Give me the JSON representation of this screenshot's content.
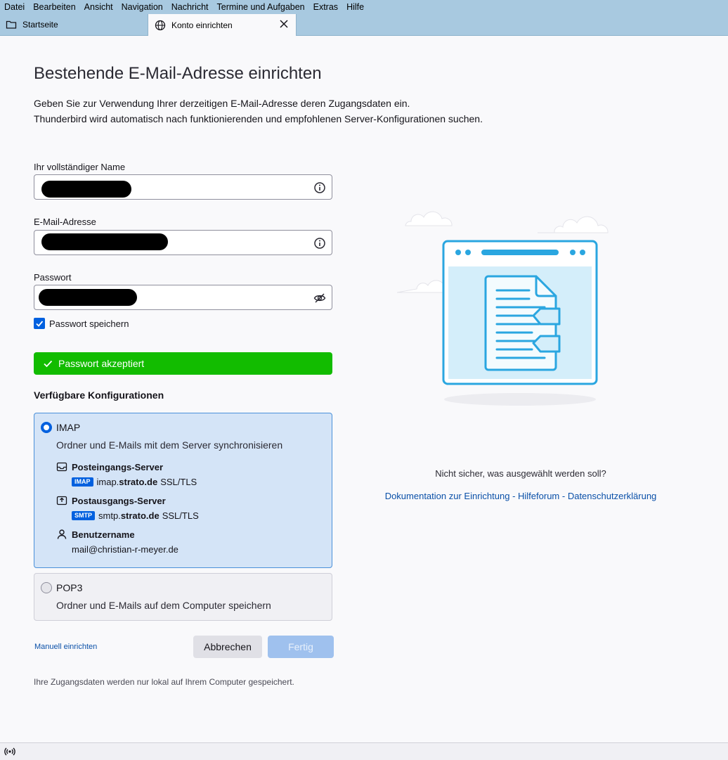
{
  "menubar": [
    "Datei",
    "Bearbeiten",
    "Ansicht",
    "Navigation",
    "Nachricht",
    "Termine und Aufgaben",
    "Extras",
    "Hilfe"
  ],
  "tabs": [
    {
      "label": "Startseite",
      "icon": "folder-icon"
    },
    {
      "label": "Konto einrichten",
      "icon": "globe-icon"
    }
  ],
  "page": {
    "title": "Bestehende E-Mail-Adresse einrichten",
    "intro_line1": "Geben Sie zur Verwendung Ihrer derzeitigen E-Mail-Adresse deren Zugangsdaten ein.",
    "intro_line2": "Thunderbird wird automatisch nach funktionierenden und empfohlenen Server-Konfigurationen suchen."
  },
  "form": {
    "name_label": "Ihr vollständiger Name",
    "email_label": "E-Mail-Adresse",
    "password_label": "Passwort",
    "save_password_label": "Passwort speichern",
    "save_password_checked": true,
    "success_message": "Passwort akzeptiert"
  },
  "configs": {
    "heading": "Verfügbare Konfigurationen",
    "imap": {
      "title": "IMAP",
      "description": "Ordner und E-Mails mit dem Server synchronisieren",
      "incoming_label": "Posteingangs-Server",
      "incoming_tag": "IMAP",
      "incoming_host_prefix": "imap.",
      "incoming_host_domain": "strato.de",
      "incoming_security": "SSL/TLS",
      "outgoing_label": "Postausgangs-Server",
      "outgoing_tag": "SMTP",
      "outgoing_host_prefix": "smtp.",
      "outgoing_host_domain": "strato.de",
      "outgoing_security": "SSL/TLS",
      "username_label": "Benutzername",
      "username_value": "mail@christian-r-meyer.de"
    },
    "pop3": {
      "title": "POP3",
      "description": "Ordner und E-Mails auf dem Computer speichern"
    }
  },
  "actions": {
    "manual": "Manuell einrichten",
    "cancel": "Abbrechen",
    "done": "Fertig"
  },
  "footnote": "Ihre Zugangsdaten werden nur lokal auf Ihrem Computer gespeichert.",
  "help": {
    "question": "Nicht sicher, was ausgewählt werden soll?",
    "doc_link": "Dokumentation zur Einrichtung",
    "sep1": " - ",
    "forum_link": "Hilfeforum",
    "sep2": " - ",
    "privacy_link": "Datenschutzerklärung"
  },
  "colors": {
    "accent": "#0060df",
    "success": "#12bc00",
    "chrome": "#a8c9e0",
    "selected_card": "#d4e4f7"
  }
}
